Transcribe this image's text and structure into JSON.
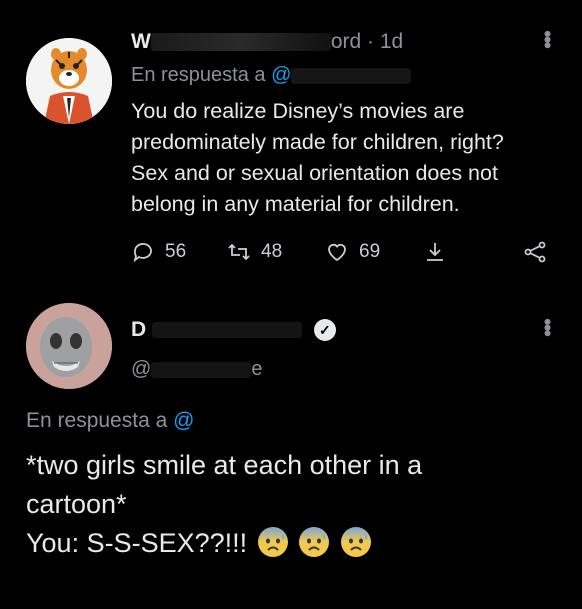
{
  "tweet1": {
    "author_name": "W",
    "author_handle_visible": "ord",
    "time": "· 1d",
    "reply_prefix": "En respuesta a",
    "reply_handle": "@",
    "body_lines": [
      "You do realize Disney’s movies are",
      "predominately made for children, right?",
      "Sex and or sexual orientation does not",
      "belong in any material for children."
    ],
    "replies": "56",
    "retweets": "48",
    "likes": "69"
  },
  "tweet2": {
    "author_name": "D",
    "handle_start": "@",
    "handle_end": "e",
    "reply_prefix": "En respuesta a",
    "reply_handle": "@",
    "body_lines": [
      "*two girls smile at each other in a",
      "cartoon*",
      "You: S-S-SEX??!!!"
    ]
  },
  "icons": {
    "reply": "reply-icon",
    "retweet": "retweet-icon",
    "like": "heart-icon",
    "share": "share-icon",
    "network": "share-network-icon",
    "more": "more-icon",
    "verified": "verified-badge-icon",
    "emoji": "anxious-face-with-sweat-emoji"
  },
  "colors": {
    "background": "#000000",
    "text": "#e7e9ea",
    "muted": "#8b9299",
    "link": "#1d9bf0"
  }
}
